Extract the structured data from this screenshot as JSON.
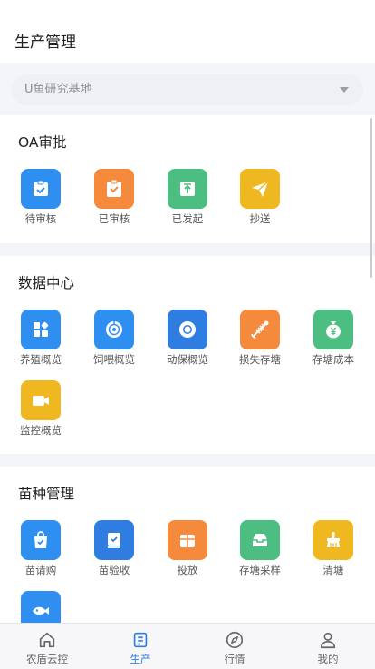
{
  "header": {
    "title": "生产管理",
    "base_select": {
      "value": "U鱼研究基地"
    }
  },
  "sections": {
    "oa": {
      "title": "OA审批",
      "items": [
        {
          "label": "待审核",
          "icon": "clipboard-check-icon",
          "color": "#2f8ff0"
        },
        {
          "label": "已审核",
          "icon": "clipboard-done-icon",
          "color": "#f58a3c"
        },
        {
          "label": "已发起",
          "icon": "upload-box-icon",
          "color": "#4cbe82"
        },
        {
          "label": "抄送",
          "icon": "paper-plane-icon",
          "color": "#f0b820"
        }
      ]
    },
    "data": {
      "title": "数据中心",
      "items": [
        {
          "label": "养殖概览",
          "icon": "grid-apps-icon",
          "color": "#2f8ff0"
        },
        {
          "label": "饲喂概览",
          "icon": "feed-target-icon",
          "color": "#2f8ff0"
        },
        {
          "label": "动保概览",
          "icon": "ring-icon",
          "color": "#2f7de1"
        },
        {
          "label": "损失存塘",
          "icon": "fish-bone-icon",
          "color": "#f58a3c"
        },
        {
          "label": "存塘成本",
          "icon": "money-bag-icon",
          "color": "#4cbe82"
        },
        {
          "label": "监控概览",
          "icon": "video-camera-icon",
          "color": "#f0b820"
        }
      ]
    },
    "seed": {
      "title": "苗种管理",
      "items": [
        {
          "label": "苗请购",
          "icon": "shopping-bag-icon",
          "color": "#2f8ff0"
        },
        {
          "label": "苗验收",
          "icon": "check-box-icon",
          "color": "#2f7de1"
        },
        {
          "label": "投放",
          "icon": "gift-box-icon",
          "color": "#f58a3c"
        },
        {
          "label": "存塘采样",
          "icon": "inbox-icon",
          "color": "#4cbe82"
        },
        {
          "label": "清塘",
          "icon": "broom-icon",
          "color": "#f0b820"
        },
        {
          "label": "",
          "icon": "fish-icon",
          "color": "#2f8ff0"
        }
      ]
    }
  },
  "tabbar": {
    "tabs": [
      {
        "label": "农盾云控",
        "icon": "home-icon",
        "active": false
      },
      {
        "label": "生产",
        "icon": "document-icon",
        "active": true
      },
      {
        "label": "行情",
        "icon": "compass-icon",
        "active": false
      },
      {
        "label": "我的",
        "icon": "user-icon",
        "active": false
      }
    ],
    "active_color": "#2f7de1"
  }
}
